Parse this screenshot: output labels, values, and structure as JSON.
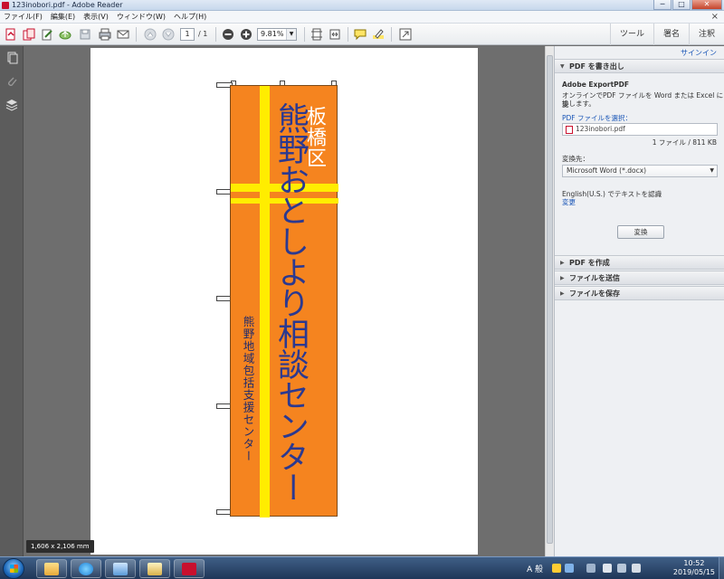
{
  "window": {
    "title": "123inobori.pdf - Adobe Reader",
    "min_label": "─",
    "max_label": "□",
    "close_label": "✕"
  },
  "menu": {
    "items": [
      "ファイル(F)",
      "編集(E)",
      "表示(V)",
      "ウィンドウ(W)",
      "ヘルプ(H)"
    ],
    "close_label": "×"
  },
  "toolbar": {
    "page_current": "1",
    "page_total": "/ 1",
    "zoom": "9.81%",
    "zoom_dropdown": "▼",
    "tabs": [
      "ツール",
      "署名",
      "注釈"
    ]
  },
  "document": {
    "page_size_badge": "1,606 x 2,106 mm",
    "banner": {
      "ward": "板橋区",
      "main": "熊野おとしより相談センター",
      "sub": "熊野地域包括支援センター",
      "colors": {
        "background": "#f5841f",
        "band": "#ffed00",
        "main_text": "#2b3990",
        "ward_text": "#ffffff"
      }
    }
  },
  "right_panel": {
    "signin": "サインイン",
    "export_section": "PDF を書き出し",
    "export_title": "Adobe ExportPDF",
    "export_desc_1": "オンラインでPDF ファイルを Word または Excel に変",
    "export_desc_2": "換します。",
    "select_file_label": "PDF ファイルを選択：",
    "file_name": "123inobori.pdf",
    "file_count": "1 ファイル / 811 KB",
    "convert_to_label": "変換先：",
    "convert_to_value": "Microsoft Word (*.docx)",
    "ocr_text": "English(U.S.) でテキストを認識",
    "change_link": "変更",
    "convert_button": "変換",
    "sections": [
      "PDF を作成",
      "ファイルを送信",
      "ファイルを保存"
    ]
  },
  "taskbar": {
    "ime": "A 般",
    "time": "10:52",
    "date": "2019/05/15"
  }
}
